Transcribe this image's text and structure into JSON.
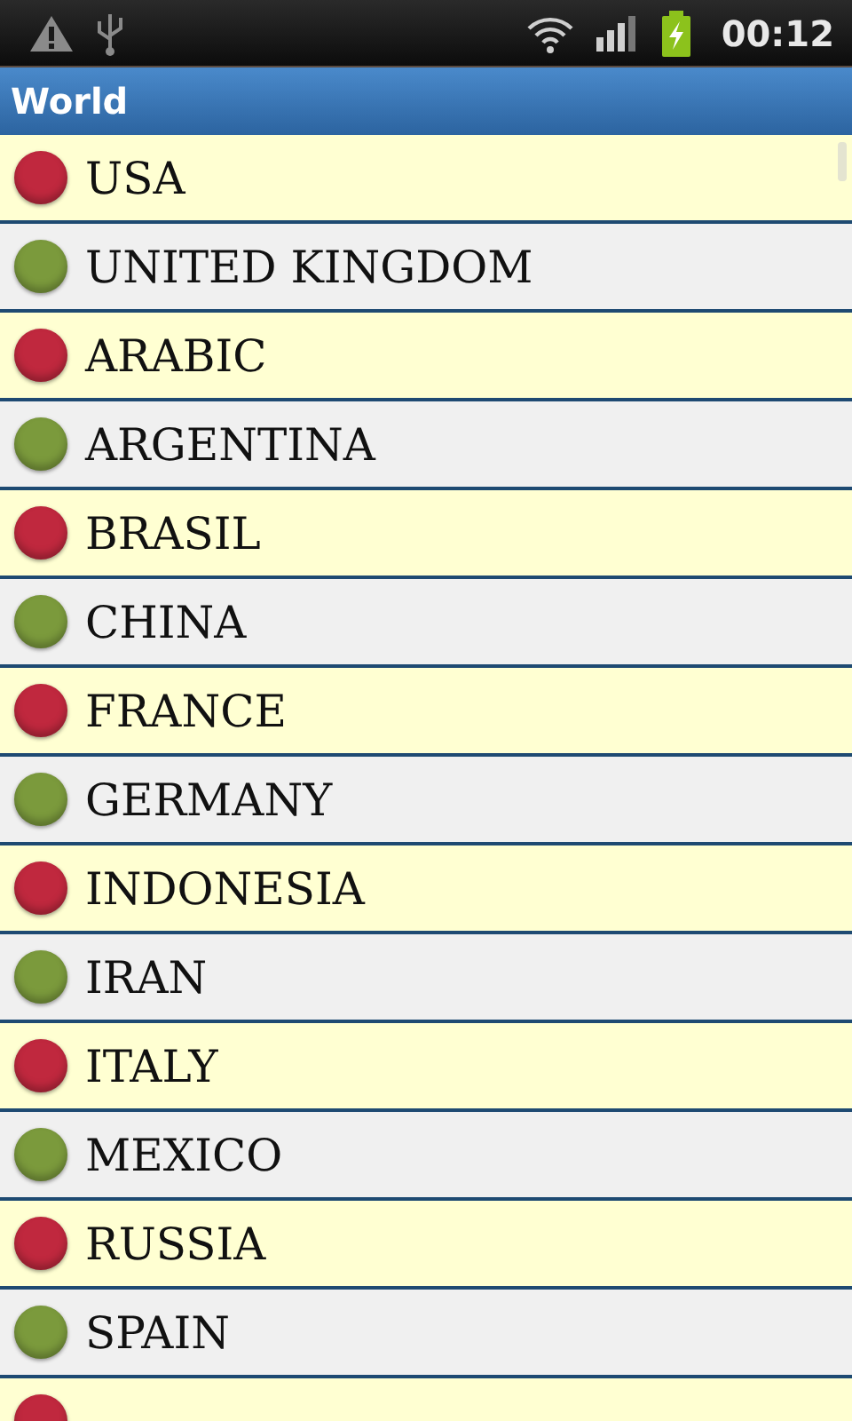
{
  "status_bar": {
    "time": "00:12"
  },
  "title_bar": {
    "title": "World"
  },
  "list": [
    {
      "label": "USA",
      "color": "#c0283e"
    },
    {
      "label": "UNITED KINGDOM",
      "color": "#7b9a3c"
    },
    {
      "label": "ARABIC",
      "color": "#c0283e"
    },
    {
      "label": "ARGENTINA",
      "color": "#7b9a3c"
    },
    {
      "label": "BRASIL",
      "color": "#c0283e"
    },
    {
      "label": "CHINA",
      "color": "#7b9a3c"
    },
    {
      "label": "FRANCE",
      "color": "#c0283e"
    },
    {
      "label": "GERMANY",
      "color": "#7b9a3c"
    },
    {
      "label": "INDONESIA",
      "color": "#c0283e"
    },
    {
      "label": "IRAN",
      "color": "#7b9a3c"
    },
    {
      "label": "ITALY",
      "color": "#c0283e"
    },
    {
      "label": "MEXICO",
      "color": "#7b9a3c"
    },
    {
      "label": "RUSSIA",
      "color": "#c0283e"
    },
    {
      "label": "SPAIN",
      "color": "#7b9a3c"
    },
    {
      "color": "#c0283e"
    }
  ]
}
